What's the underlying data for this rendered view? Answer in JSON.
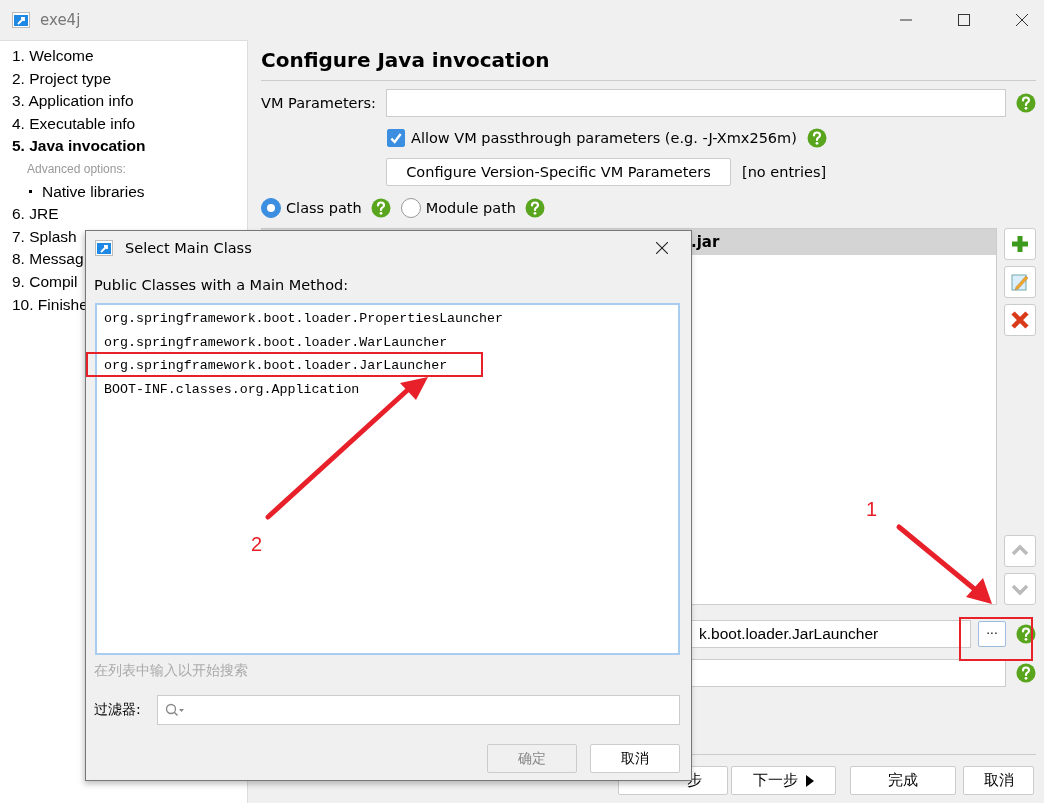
{
  "window": {
    "title": "exe4j"
  },
  "sidebar": [
    {
      "kind": "step",
      "label": "1. Welcome",
      "selected": false
    },
    {
      "kind": "step",
      "label": "2. Project type",
      "selected": false
    },
    {
      "kind": "step",
      "label": "3. Application info",
      "selected": false
    },
    {
      "kind": "step",
      "label": "4. Executable info",
      "selected": false
    },
    {
      "kind": "step",
      "label": "5. Java invocation",
      "selected": true
    },
    {
      "kind": "caption",
      "label": "Advanced options:"
    },
    {
      "kind": "subitem",
      "label": "Native libraries",
      "selected": false
    },
    {
      "kind": "step",
      "label": "6. JRE",
      "selected": false
    },
    {
      "kind": "step",
      "label": "7. Splash",
      "selected": false
    },
    {
      "kind": "step",
      "label": "8. Messag",
      "selected": false
    },
    {
      "kind": "step",
      "label": "9. Compil",
      "selected": false
    },
    {
      "kind": "step",
      "label": "10. Finishe",
      "selected": false
    }
  ],
  "page": {
    "title": "Configure Java invocation",
    "vm_label": "VM Parameters:",
    "passthrough": {
      "label": "Allow VM passthrough parameters (e.g. -J-Xmx256m)",
      "checked": true
    },
    "version_button": "Configure Version-Specific VM Parameters",
    "version_status": "[no entries]",
    "path_modes": [
      {
        "label": "Class path",
        "selected": true
      },
      {
        "label": "Module path",
        "selected": false
      }
    ],
    "class_path_header": ".jar",
    "main_class": {
      "value": "k.boot.loader.JarLauncher",
      "browse": "···"
    },
    "nav_buttons": [
      {
        "kind": "back",
        "label": "步"
      },
      {
        "kind": "next",
        "label": "下一步"
      },
      {
        "kind": "plain",
        "label": "完成"
      },
      {
        "kind": "plain",
        "label": "取消"
      }
    ]
  },
  "dialog": {
    "title": "Select Main Class",
    "list_label": "Public Classes with a Main Method:",
    "classes": [
      {
        "label": "org.springframework.boot.loader.PropertiesLauncher",
        "selected": false
      },
      {
        "label": "org.springframework.boot.loader.WarLauncher",
        "selected": false
      },
      {
        "label": "org.springframework.boot.loader.JarLauncher",
        "selected": false
      },
      {
        "label": "BOOT-INF.classes.org.Application",
        "selected": false
      }
    ],
    "hint": "在列表中输入以开始搜索",
    "filter_label": "过滤器:",
    "buttons": [
      {
        "label": "确定",
        "disabled": true
      },
      {
        "label": "取消",
        "disabled": false
      }
    ]
  },
  "annotations": [
    {
      "label": "1"
    },
    {
      "label": "2"
    }
  ]
}
